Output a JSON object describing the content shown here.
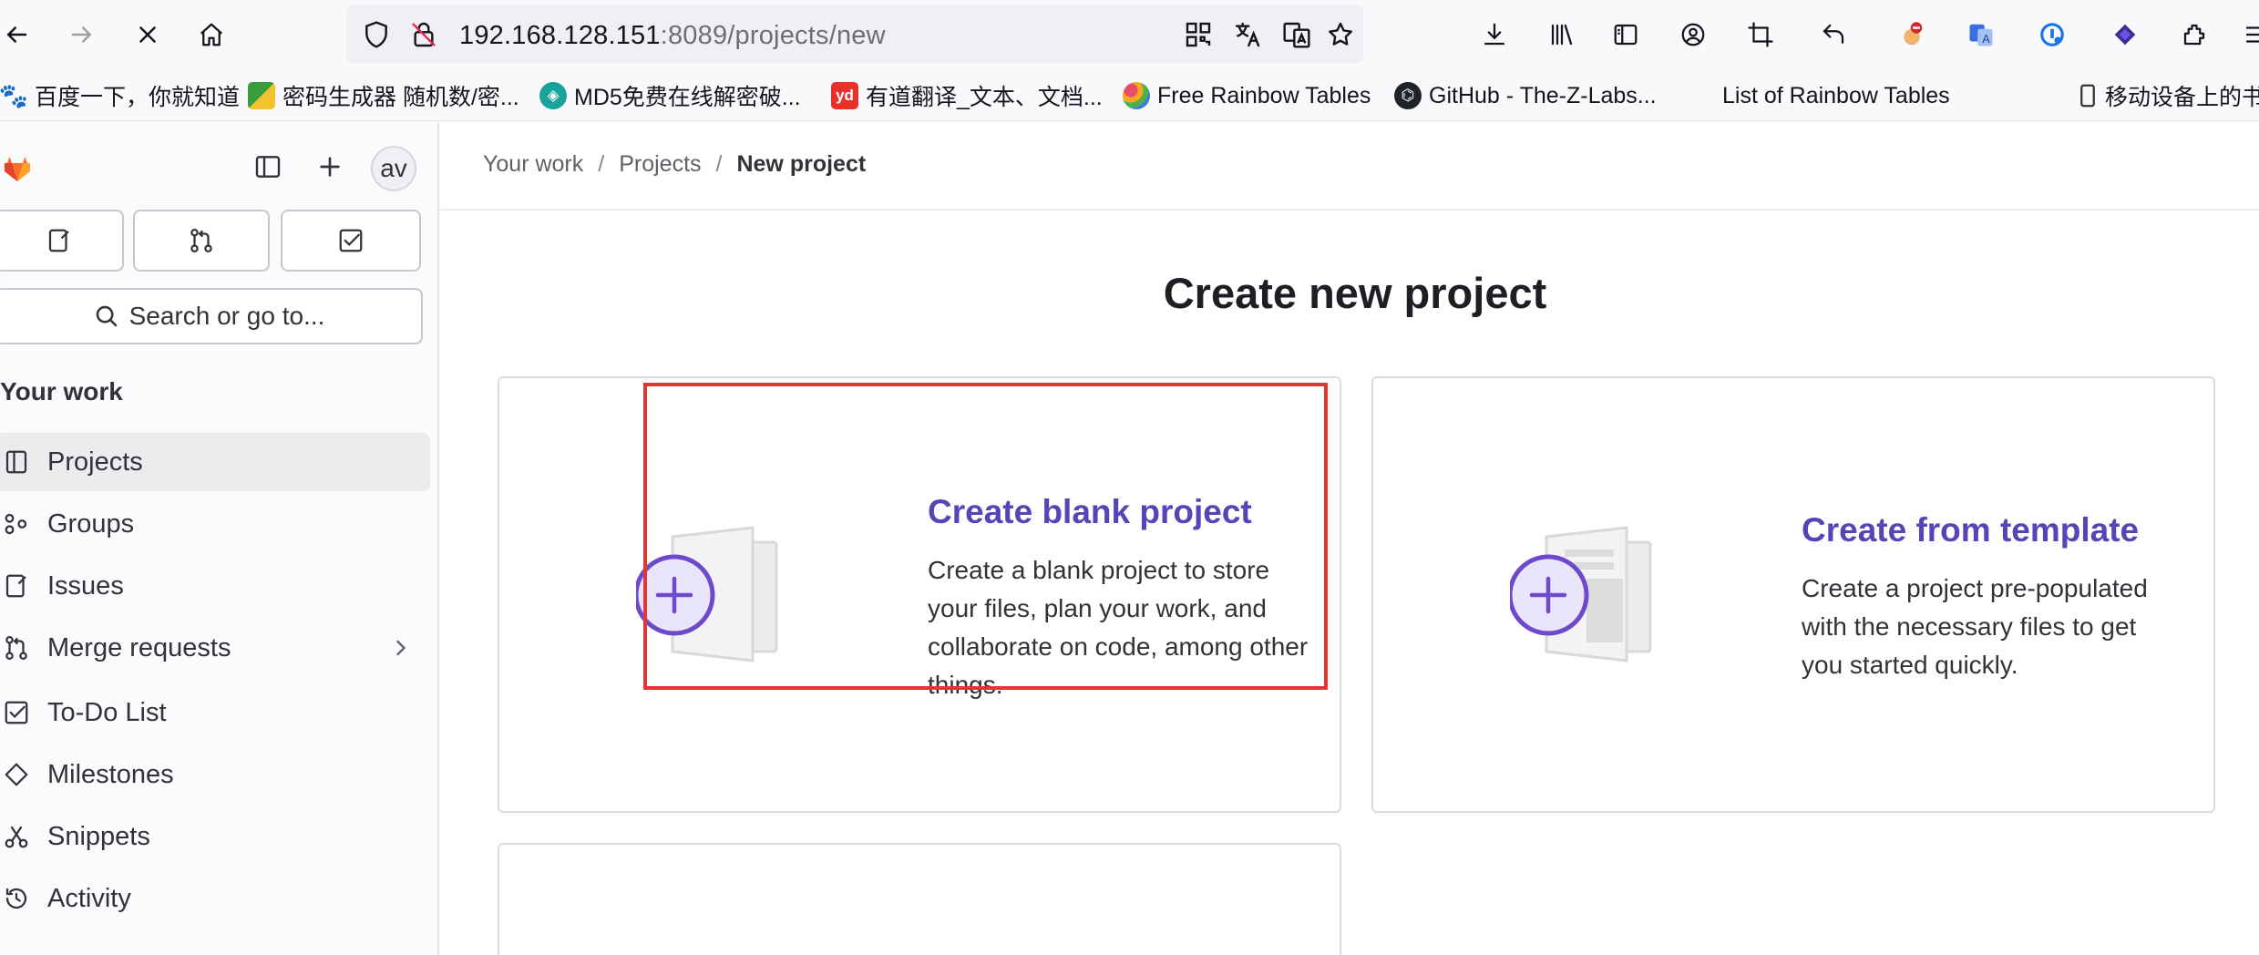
{
  "browser": {
    "url_host": "192.168.128.151",
    "url_path": ":8089/projects/new",
    "bookmarks": [
      {
        "label": "百度一下，你就知道",
        "icon": "baidu-icon",
        "color": "#2932e1"
      },
      {
        "label": "密码生成器 随机数/密...",
        "icon": "password-generator-icon",
        "color": "#3b9c3b"
      },
      {
        "label": "MD5免费在线解密破...",
        "icon": "md5-icon",
        "color": "#1aa39a"
      },
      {
        "label": "有道翻译_文本、文档...",
        "icon": "youdao-icon",
        "color": "#e9302a",
        "glyph": "yd"
      },
      {
        "label": "Free Rainbow Tables",
        "icon": "rainbow-icon",
        "color": "#f5a623"
      },
      {
        "label": "GitHub - The-Z-Labs...",
        "icon": "github-icon",
        "color": "#1f2328"
      },
      {
        "label": "List of Rainbow Tables",
        "icon": "blank-page-icon",
        "color": "#ffffff"
      },
      {
        "label": "移动设备上的书",
        "icon": "mobile-device-icon",
        "color": "#333333"
      }
    ]
  },
  "sidebar": {
    "avatar_text": "av",
    "search_label": "Search or go to...",
    "section_heading": "Your work",
    "items": [
      {
        "label": "Projects",
        "icon": "project-icon",
        "active": true
      },
      {
        "label": "Groups",
        "icon": "group-icon"
      },
      {
        "label": "Issues",
        "icon": "issues-icon"
      },
      {
        "label": "Merge requests",
        "icon": "merge-request-icon",
        "expandable": true
      },
      {
        "label": "To-Do List",
        "icon": "todo-icon"
      },
      {
        "label": "Milestones",
        "icon": "milestone-icon"
      },
      {
        "label": "Snippets",
        "icon": "snippet-icon"
      },
      {
        "label": "Activity",
        "icon": "history-icon"
      }
    ]
  },
  "breadcrumb": {
    "items": [
      "Your work",
      "Projects"
    ],
    "current": "New project"
  },
  "page": {
    "title": "Create new project",
    "cards": [
      {
        "title": "Create blank project",
        "description": "Create a blank project to store your files, plan your work, and collaborate on code, among other things.",
        "icon": "blank-project-illustration"
      },
      {
        "title": "Create from template",
        "description": "Create a project pre-populated with the necessary files to get you started quickly.",
        "icon": "template-project-illustration"
      }
    ]
  },
  "colors": {
    "accent": "#5943b6",
    "highlight": "#e23535",
    "gitlab_orange": "#fc6d26"
  }
}
